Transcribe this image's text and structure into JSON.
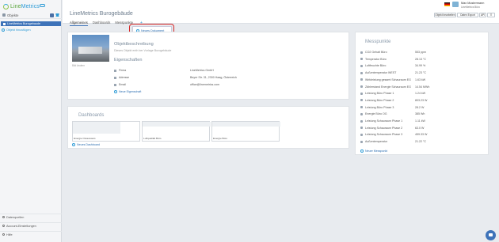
{
  "app": {
    "logo_prefix": "Line",
    "logo_suffix": "Metrics"
  },
  "sidebar": {
    "header": "Objekte",
    "selected_item": "LineMetrics Burogebaude",
    "add_object": "Objekt hinzufügen",
    "footer": [
      "Datenquellen",
      "Account-Einstellungen",
      "Hilfe"
    ]
  },
  "header": {
    "title": "LineMetrics Burogebäude",
    "user_name": "Max Mustermann",
    "user_company": "LineMetrics Büro",
    "buttons": {
      "edit": "Objekt bearbeiten",
      "export": "Daten Export",
      "api": "API",
      "menu": "☰"
    },
    "tabs": [
      "Allgemeines",
      "Dashboards",
      "Messpunkte"
    ],
    "tab_add": "+"
  },
  "dropdown": {
    "label": "Neues Dokument"
  },
  "object": {
    "image_caption": "Bild ändern",
    "description_title": "Objektbeschreibung",
    "description": "Dieses Objekt enth ber Vorlage Burogebäude",
    "properties_title": "Eigenschaften",
    "properties": [
      {
        "label": "Firma",
        "value": "LineMetrics GmbH"
      },
      {
        "label": "Adresse",
        "value": "Beyer Str. 31, 2300 Haag, Österreich"
      },
      {
        "label": "Email",
        "value": "office@linemetrics.com"
      }
    ],
    "add_property": "Neue Eigenschaft"
  },
  "dashboards": {
    "title": "Dashboards",
    "items": [
      "Energie Ostausweis",
      "Luftqualität Büro",
      "Energie Büro"
    ],
    "add": "Neues Dashboard"
  },
  "messpunkte": {
    "title": "Messpunkte",
    "items": [
      {
        "label": "CO2 Gehalt Büro",
        "value": "553 ppm"
      },
      {
        "label": "Temperatur Büro",
        "value": "28.13 °C"
      },
      {
        "label": "Luftfeuchte Büro",
        "value": "34.99 %"
      },
      {
        "label": "Außentemperatur WEST",
        "value": "21.23 °C"
      },
      {
        "label": "Wirkleistung gesamt Schauraum EG",
        "value": "1.63 kW"
      },
      {
        "label": "Zählerstand Energie Schauraum EG",
        "value": "14.54 MWh"
      },
      {
        "label": "Leistung Büro Phase 1",
        "value": "1.24 kW"
      },
      {
        "label": "Leistung Büro Phase 2",
        "value": "803.23 W"
      },
      {
        "label": "Leistung Büro Phase 3",
        "value": "28.2 W"
      },
      {
        "label": "Energie Büro OG",
        "value": "385 Wh"
      },
      {
        "label": "Leistung Schauraum Phase 1",
        "value": "1.11 kW"
      },
      {
        "label": "Leistung Schauraum Phase 2",
        "value": "63.0 W"
      },
      {
        "label": "Leistung Schauraum Phase 3",
        "value": "459.33 W"
      },
      {
        "label": "Außentemperatur",
        "value": "21.22 °C"
      }
    ],
    "add": "Neuer Messpunkt"
  }
}
